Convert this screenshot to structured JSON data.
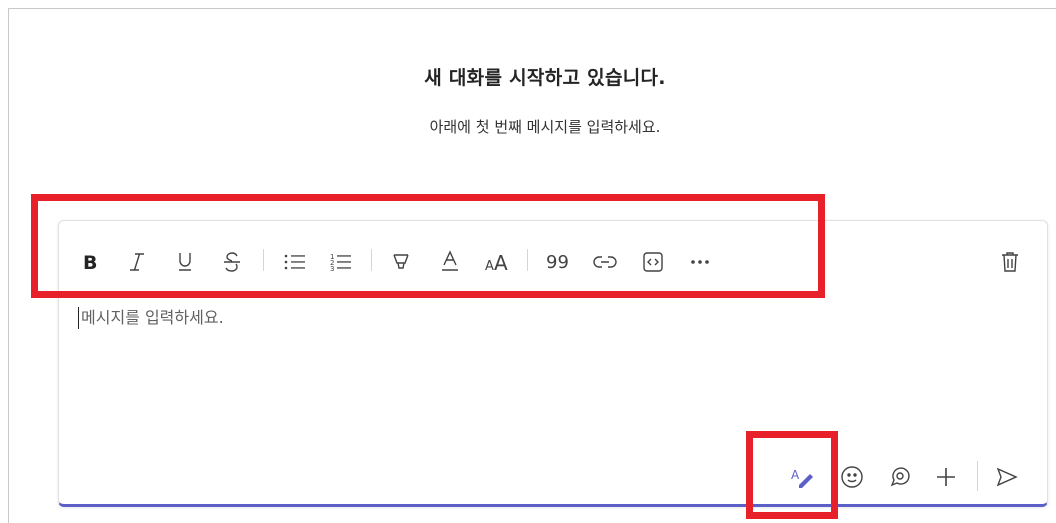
{
  "header": {
    "title": "새 대화를 시작하고 있습니다.",
    "subtitle": "아래에 첫 번째 메시지를 입력하세요."
  },
  "compose": {
    "placeholder": "메시지를 입력하세요."
  },
  "toolbar": {
    "items": [
      {
        "name": "bold-icon"
      },
      {
        "name": "italic-icon"
      },
      {
        "name": "underline-icon"
      },
      {
        "name": "strikethrough-icon"
      },
      {
        "name": "bulleted-list-icon"
      },
      {
        "name": "numbered-list-icon"
      },
      {
        "name": "highlight-icon"
      },
      {
        "name": "font-color-icon"
      },
      {
        "name": "font-size-icon"
      },
      {
        "name": "quote-icon"
      },
      {
        "name": "link-icon"
      },
      {
        "name": "code-snippet-icon"
      },
      {
        "name": "more-options-icon"
      },
      {
        "name": "delete-icon"
      }
    ]
  },
  "actions": [
    {
      "name": "format-icon"
    },
    {
      "name": "emoji-icon"
    },
    {
      "name": "loop-icon"
    },
    {
      "name": "attach-icon"
    },
    {
      "name": "send-icon"
    }
  ],
  "colors": {
    "accent": "#5b5fc7",
    "highlight_box": "#e8202a",
    "text": "#242424"
  }
}
